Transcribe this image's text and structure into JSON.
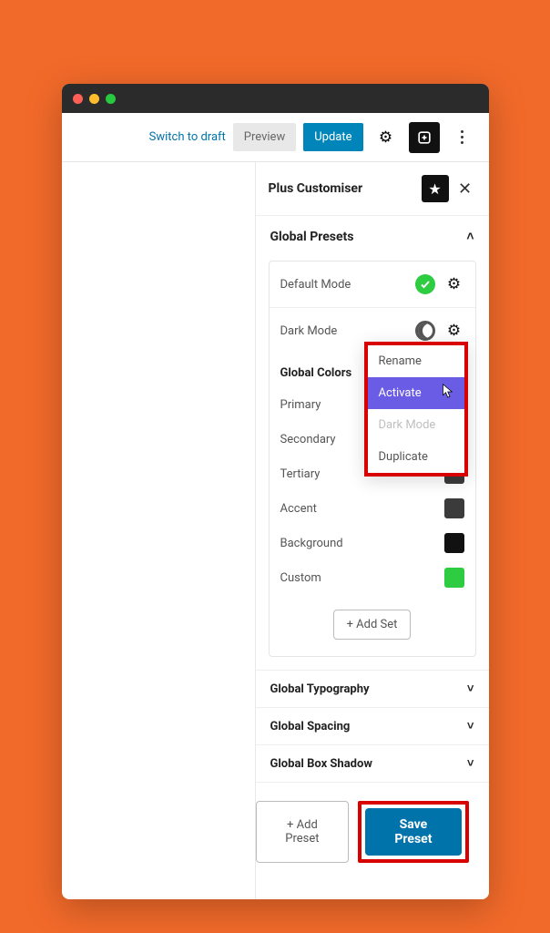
{
  "topbar": {
    "switch_to_draft": "Switch to draft",
    "preview": "Preview",
    "update": "Update"
  },
  "panel": {
    "title": "Plus Customiser"
  },
  "section_presets": {
    "title": "Global Presets"
  },
  "presets": {
    "default_mode": "Default Mode",
    "dark_mode": "Dark Mode"
  },
  "colors_section": {
    "title": "Global Colors",
    "items": [
      {
        "label": "Primary",
        "hex": "#3b3b3b"
      },
      {
        "label": "Secondary",
        "hex": "#3b3b3b"
      },
      {
        "label": "Tertiary",
        "hex": "#3b3b3b"
      },
      {
        "label": "Accent",
        "hex": "#3b3b3b"
      },
      {
        "label": "Background",
        "hex": "#111111"
      },
      {
        "label": "Custom",
        "hex": "#2ecc40"
      }
    ],
    "add_set": "+ Add Set"
  },
  "accordions": {
    "typography": "Global Typography",
    "spacing": "Global Spacing",
    "boxshadow": "Global Box Shadow"
  },
  "context_menu": {
    "rename": "Rename",
    "activate": "Activate",
    "darkmode": "Dark Mode",
    "duplicate": "Duplicate"
  },
  "footer": {
    "add_preset": "+ Add Preset",
    "save_preset": "Save Preset"
  },
  "icons": {
    "settings": "settings-icon",
    "plugin": "plugin-icon",
    "kebab": "kebab-icon",
    "star": "star-icon",
    "close": "close-icon",
    "moon": "moon-icon",
    "check": "check-icon"
  }
}
